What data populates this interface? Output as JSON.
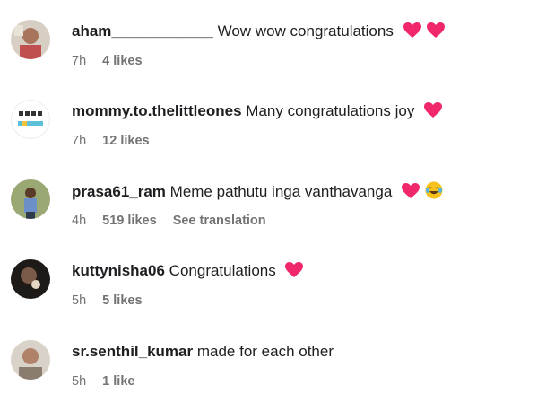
{
  "comments": [
    {
      "username": "aham____________",
      "text": "Wow wow congratulations",
      "emojis": [
        "heart",
        "heart"
      ],
      "time": "7h",
      "likes": "4 likes",
      "translate": ""
    },
    {
      "username": "mommy.to.thelittleones",
      "text": "Many congratulations joy",
      "emojis": [
        "heart"
      ],
      "time": "7h",
      "likes": "12 likes",
      "translate": ""
    },
    {
      "username": "prasa61_ram",
      "text": "Meme pathutu inga vanthavanga",
      "emojis": [
        "heart",
        "laughing-face"
      ],
      "time": "4h",
      "likes": "519 likes",
      "translate": "See translation"
    },
    {
      "username": "kuttynisha06",
      "text": "Congratulations",
      "emojis": [
        "heart"
      ],
      "time": "5h",
      "likes": "5 likes",
      "translate": ""
    },
    {
      "username": "sr.senthil_kumar",
      "text": "made for each other",
      "emojis": [],
      "time": "5h",
      "likes": "1 like",
      "translate": ""
    }
  ],
  "colors": {
    "heart": "#f0286b",
    "meta": "#737373"
  }
}
